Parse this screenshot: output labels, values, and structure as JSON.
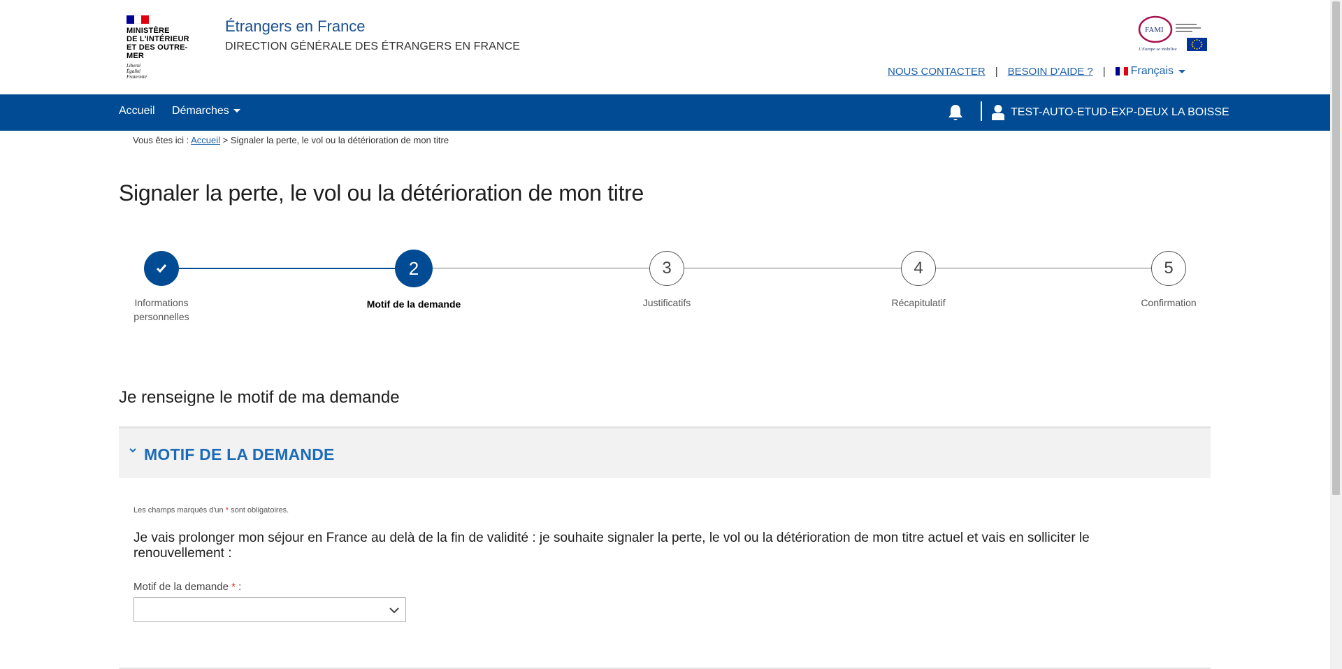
{
  "header": {
    "ministry_lines": [
      "MINISTÈRE",
      "DE L'INTÉRIEUR",
      "ET DES OUTRE-MER"
    ],
    "devise_lines": [
      "Liberté",
      "Égalité",
      "Fraternité"
    ],
    "site_title": "Étrangers en France",
    "site_subtitle": "DIRECTION GÉNÉRALE DES ÉTRANGERS EN FRANCE",
    "fami_label": "FAMI",
    "fami_caption": "L'Europe se mobilise",
    "contact_link": "NOUS CONTACTER",
    "help_link": "BESOIN D'AIDE ?",
    "separator": "|",
    "language": "Français"
  },
  "navbar": {
    "home": "Accueil",
    "procedures": "Démarches",
    "user_name": "TEST-AUTO-ETUD-EXP-DEUX LA BOISSE"
  },
  "breadcrumb": {
    "prefix": "Vous êtes ici :",
    "home": "Accueil",
    "separator": ">",
    "current": "Signaler la perte, le vol ou la détérioration de mon titre"
  },
  "page_title": "Signaler la perte, le vol ou la détérioration de mon titre",
  "stepper": {
    "steps": [
      {
        "number": "✓",
        "label_line1": "Informations",
        "label_line2": "personnelles",
        "state": "done"
      },
      {
        "number": "2",
        "label_line1": "Motif de la demande",
        "label_line2": "",
        "state": "active"
      },
      {
        "number": "3",
        "label_line1": "Justificatifs",
        "label_line2": "",
        "state": "todo"
      },
      {
        "number": "4",
        "label_line1": "Récapitulatif",
        "label_line2": "",
        "state": "todo"
      },
      {
        "number": "5",
        "label_line1": "Confirmation",
        "label_line2": "",
        "state": "todo"
      }
    ]
  },
  "section": {
    "title": "Je renseigne le motif de ma demande",
    "accordion_title": "MOTIF DE LA DEMANDE",
    "required_note_before": "Les champs marqués d'un",
    "required_note_star": "*",
    "required_note_after": "sont obligatoires.",
    "question": "Je vais prolonger mon séjour en France au delà de la fin de validité : je souhaite signaler la perte, le vol ou la détérioration de mon titre actuel et vais en solliciter le renouvellement :",
    "field_label": "Motif de la demande",
    "field_star": "*",
    "field_colon": ":",
    "field_value": ""
  },
  "colors": {
    "navbar_bg": "#004b93",
    "accent_blue": "#1b6bb9",
    "required_red": "#d32f2f",
    "flag_blue": "#000091",
    "flag_red": "#e1000f"
  }
}
